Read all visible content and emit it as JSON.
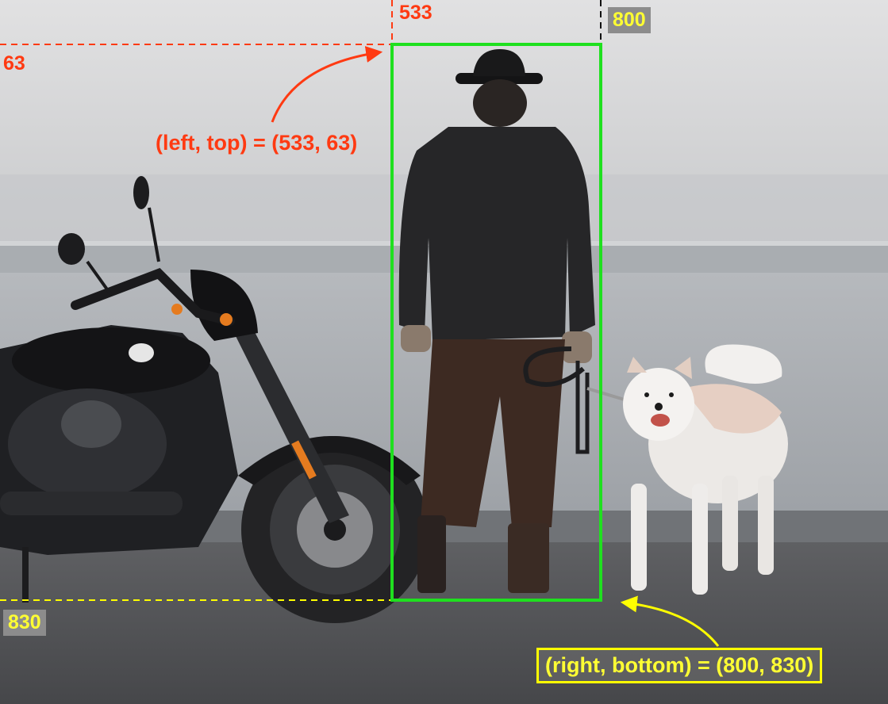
{
  "annotations": {
    "left_value": "533",
    "top_value": "63",
    "right_value": "800",
    "bottom_value": "830",
    "left_top_label": "(left, top) = (533, 63)",
    "right_bottom_label": "(right, bottom) = (800, 830)"
  },
  "colors": {
    "box_outline": "#1fe01f",
    "left_top_guides": "#ff3a12",
    "right_bottom_guides": "#ffff00",
    "tag_background": "#8c8c8c"
  },
  "subjects": [
    "person-in-hat-and-leather-jacket",
    "motorcycle",
    "white-dog-on-leash"
  ]
}
